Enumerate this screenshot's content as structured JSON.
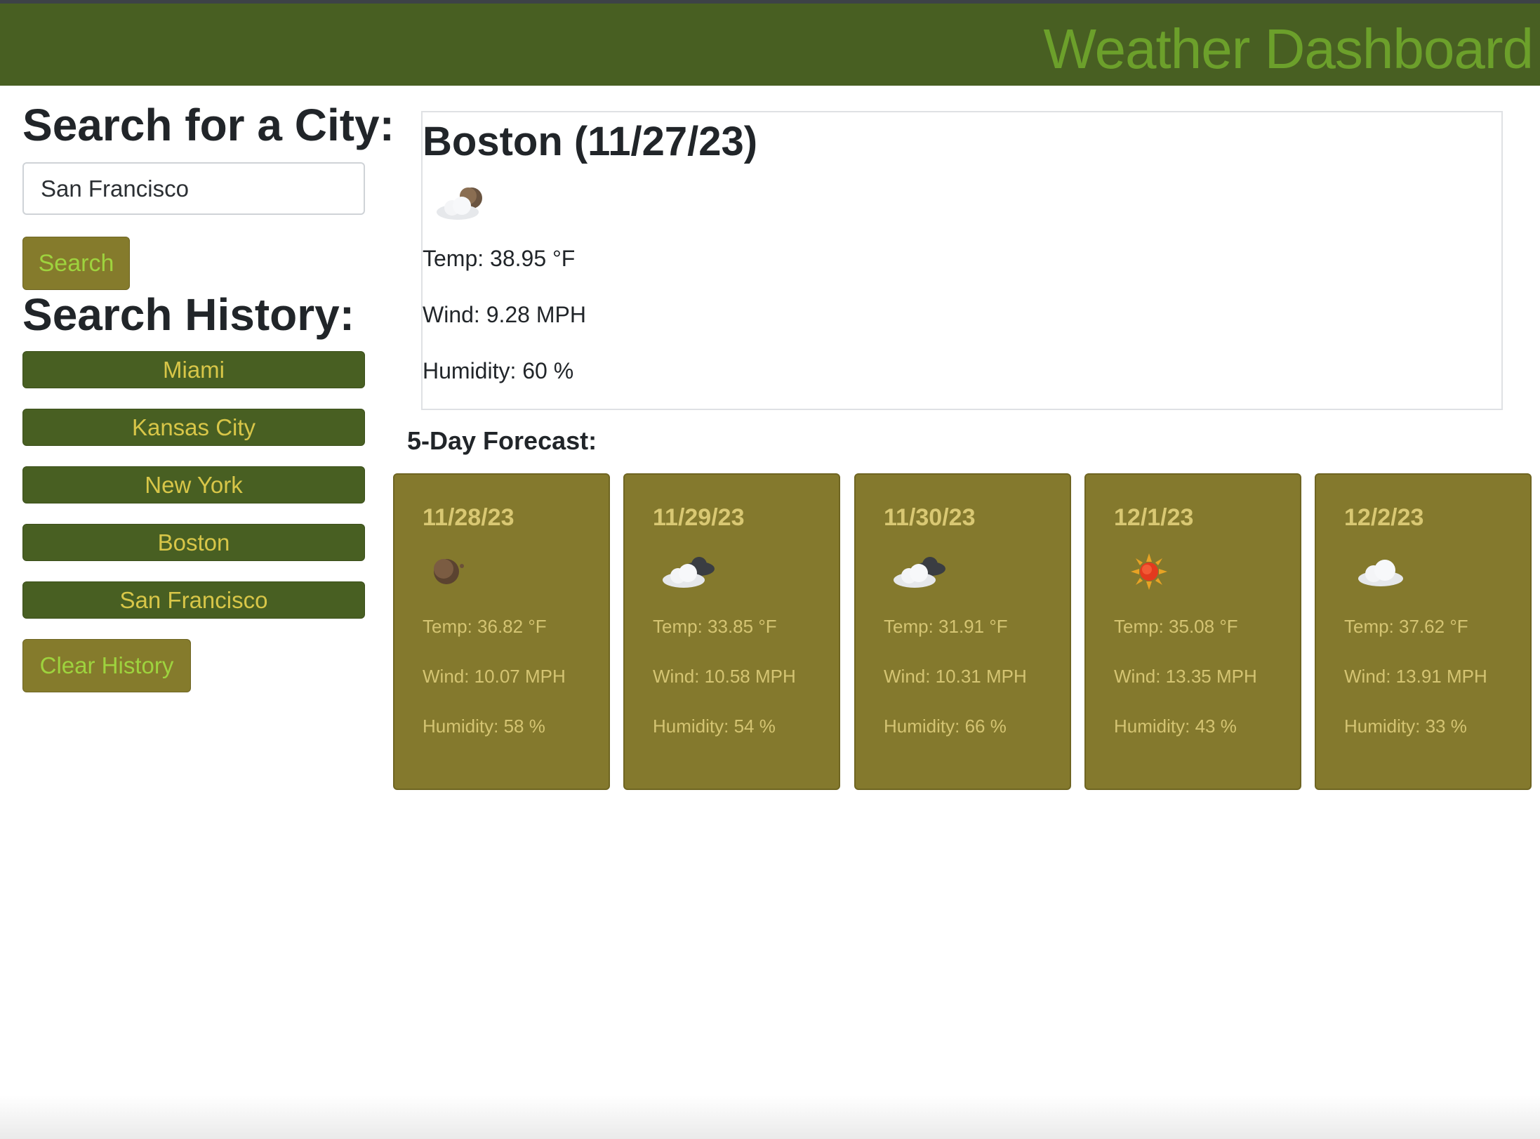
{
  "header": {
    "title": "Weather Dashboard"
  },
  "search": {
    "title": "Search for a City:",
    "input_value": "San Francisco",
    "button_label": "Search"
  },
  "history": {
    "title": "Search History:",
    "items": [
      "Miami",
      "Kansas City",
      "New York",
      "Boston",
      "San Francisco"
    ],
    "clear_label": "Clear History"
  },
  "current": {
    "title": "Boston (11/27/23)",
    "icon": "partly-cloudy-night-icon",
    "temp": "Temp: 38.95 °F",
    "wind": "Wind: 9.28 MPH",
    "humidity": "Humidity: 60 %"
  },
  "forecast": {
    "title": "5-Day Forecast:",
    "days": [
      {
        "date": "11/28/23",
        "icon": "moon-icon",
        "temp": "Temp: 36.82 °F",
        "wind": "Wind: 10.07 MPH",
        "humidity": "Humidity: 58 %"
      },
      {
        "date": "11/29/23",
        "icon": "cloudy-icon",
        "temp": "Temp: 33.85 °F",
        "wind": "Wind: 10.58 MPH",
        "humidity": "Humidity: 54 %"
      },
      {
        "date": "11/30/23",
        "icon": "cloudy-icon",
        "temp": "Temp: 31.91 °F",
        "wind": "Wind: 10.31 MPH",
        "humidity": "Humidity: 66 %"
      },
      {
        "date": "12/1/23",
        "icon": "sun-icon",
        "temp": "Temp: 35.08 °F",
        "wind": "Wind: 13.35 MPH",
        "humidity": "Humidity: 43 %"
      },
      {
        "date": "12/2/23",
        "icon": "cloud-icon",
        "temp": "Temp: 37.62 °F",
        "wind": "Wind: 13.91 MPH",
        "humidity": "Humidity: 33 %"
      }
    ]
  },
  "colors": {
    "header_bg": "#485f22",
    "header_text": "#6ca02b",
    "card_bg": "#84792d",
    "history_btn_bg": "#485f22"
  }
}
